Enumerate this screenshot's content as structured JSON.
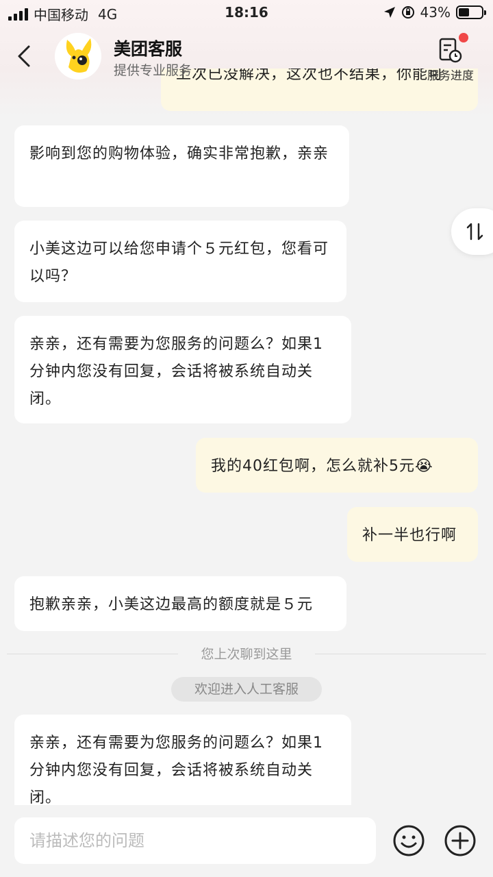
{
  "status_bar": {
    "carrier": "中国移动",
    "network": "4G",
    "time": "18:16",
    "battery": "43%"
  },
  "header": {
    "title": "美团客服",
    "subtitle": "提供专业服务",
    "progress_label": "服务进度"
  },
  "messages": {
    "partial_top": "上次已没解决，这次也不结果，你能可",
    "m1": "影响到您的购物体验，确实非常抱歉，亲亲",
    "m2": "小美这边可以给您申请个５元红包，您看可以吗？",
    "m3": "亲亲，还有需要为您服务的问题么？如果1分钟内您没有回复，会话将被系统自动关闭。",
    "m4": "我的40红包啊，怎么就补5元",
    "m4_emoji": "😭",
    "m5": "补一半也行啊",
    "m6": "抱歉亲亲，小美这边最高的额度就是５元",
    "divider": "您上次聊到这里",
    "system_pill": "欢迎进入人工客服",
    "m7": "亲亲，还有需要为您服务的问题么？如果1分钟内您没有回复，会话将被系统自动关闭。"
  },
  "input": {
    "placeholder": "请描述您的问题"
  },
  "icons": {
    "back": "chevron-left-icon",
    "progress": "document-clock-icon",
    "sort": "up-down-arrows-icon",
    "emoji": "smiley-icon",
    "add": "plus-circle-icon"
  },
  "colors": {
    "user_bubble": "#fdf8e3",
    "agent_bubble": "#ffffff",
    "background": "#f3f3f3",
    "notification_dot": "#f04848"
  }
}
